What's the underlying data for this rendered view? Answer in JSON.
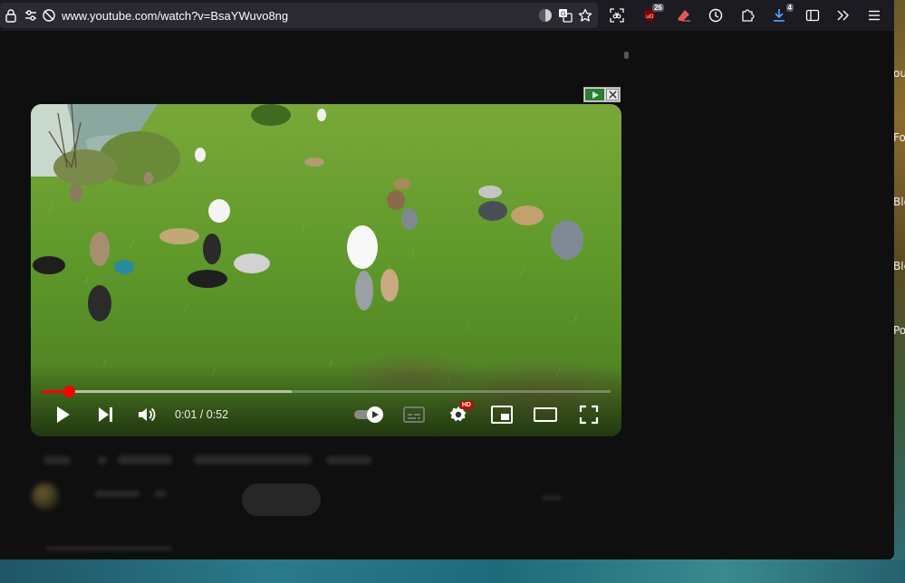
{
  "browser": {
    "url": "www.youtube.com/watch?v=BsaYWuvo8ng",
    "extensions": {
      "ublock_count": "26",
      "downloads_count": "4"
    }
  },
  "player": {
    "time_display": "0:01 / 0:52",
    "progress_played_fraction": 0.047,
    "progress_buffered_fraction": 0.44,
    "quality_badge": "HD",
    "colors": {
      "progress": "#ff0000",
      "quality_badge": "#cc0000"
    }
  },
  "wallpaper_text": {
    "label_1": "ou",
    "label_2": "Fo",
    "label_3": "Ble",
    "label_4": "Ble",
    "label_5": "Po"
  },
  "icons": {
    "toolbar": [
      "lock-icon",
      "permissions-icon",
      "tracking-protection-icon",
      "reader-icon",
      "translate-icon",
      "bookmark-star-icon",
      "screenshot-icon",
      "ublock-icon",
      "eraser-icon",
      "history-icon",
      "extensions-icon",
      "downloads-icon",
      "sidebar-icon",
      "overflow-icon",
      "menu-icon"
    ],
    "player": [
      "play-icon",
      "next-icon",
      "volume-icon",
      "autoplay-toggle-icon",
      "subtitles-icon",
      "settings-icon",
      "miniplayer-icon",
      "theater-icon",
      "fullscreen-icon"
    ]
  }
}
